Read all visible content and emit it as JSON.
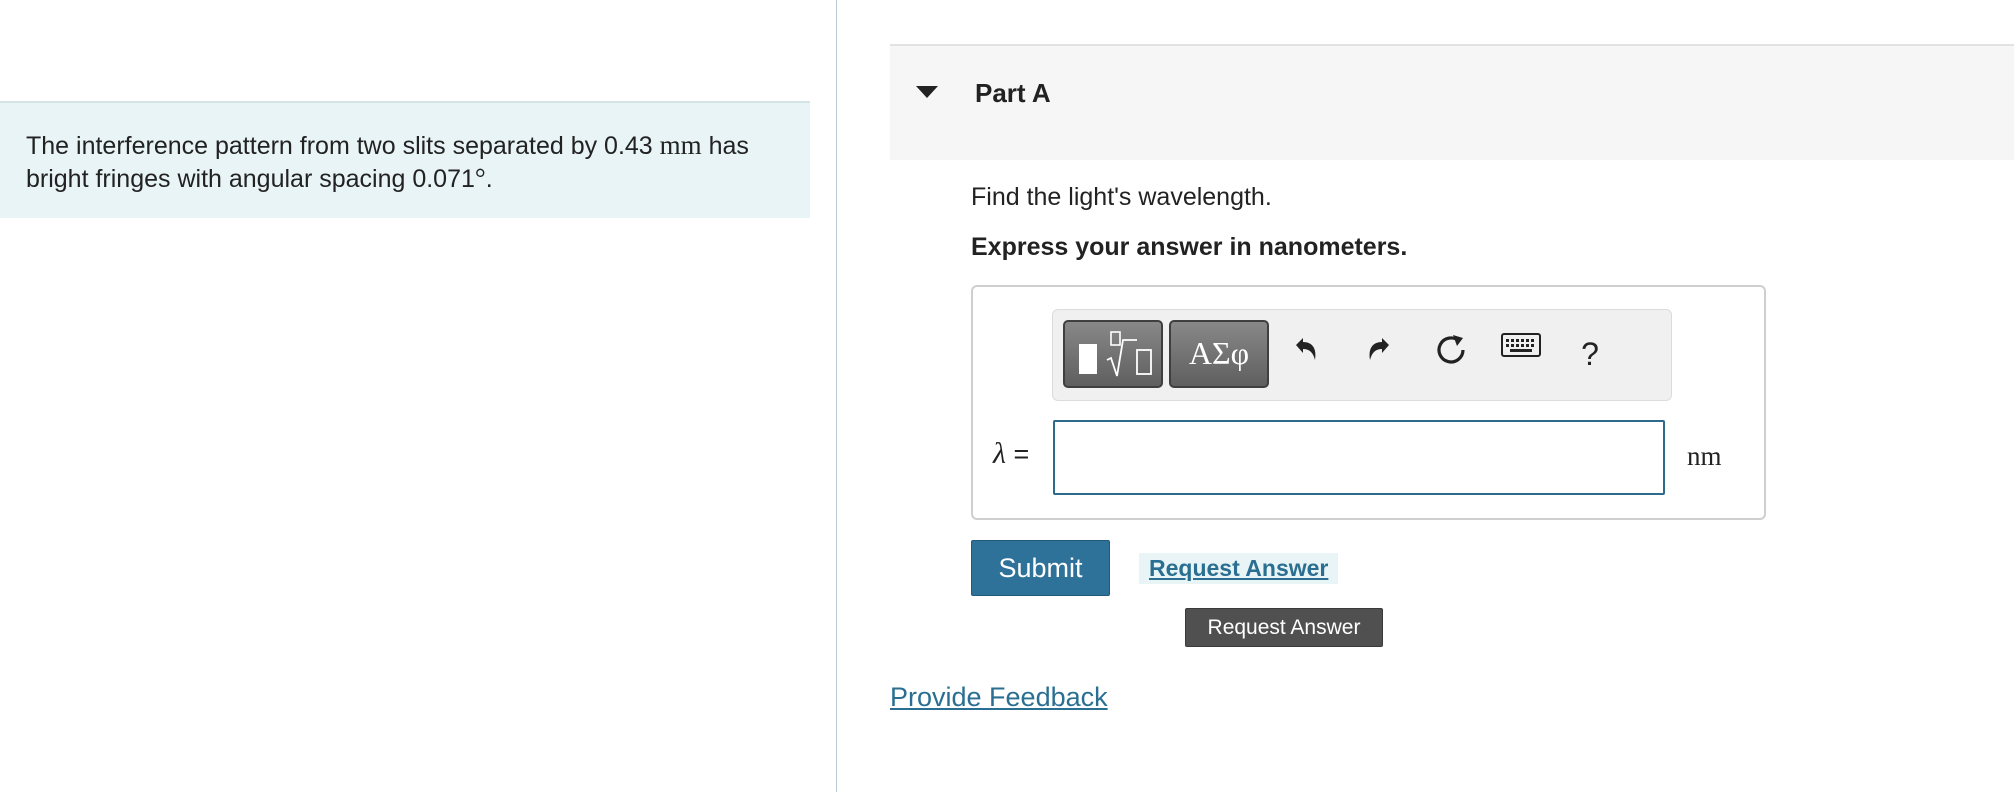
{
  "problem": {
    "text_before": "The interference pattern from two slits separated by 0.43 ",
    "unit_mm": "mm",
    "text_after": " has bright fringes with angular spacing 0.071",
    "degree": "°",
    "period": "."
  },
  "part": {
    "title": "Part A",
    "caret_icon": "caret-down-icon",
    "question": "Find the light's wavelength.",
    "instruction": "Express your answer in nanometers."
  },
  "toolbar": {
    "templates_icon": "templates-icon",
    "greek_label": "ΑΣφ",
    "undo_icon": "undo-icon",
    "redo_icon": "redo-icon",
    "reset_icon": "reset-icon",
    "keyboard_icon": "keyboard-icon",
    "help_label": "?"
  },
  "answer": {
    "variable": "λ",
    "equals": " =",
    "value": "",
    "unit": "nm"
  },
  "actions": {
    "submit_label": "Submit",
    "request_answer_label": "Request Answer",
    "tooltip_text": "Request Answer",
    "feedback_label": "Provide Feedback"
  },
  "colors": {
    "accent": "#2f7299",
    "link": "#2a6f91",
    "panel_bg": "#e8f4f6"
  }
}
